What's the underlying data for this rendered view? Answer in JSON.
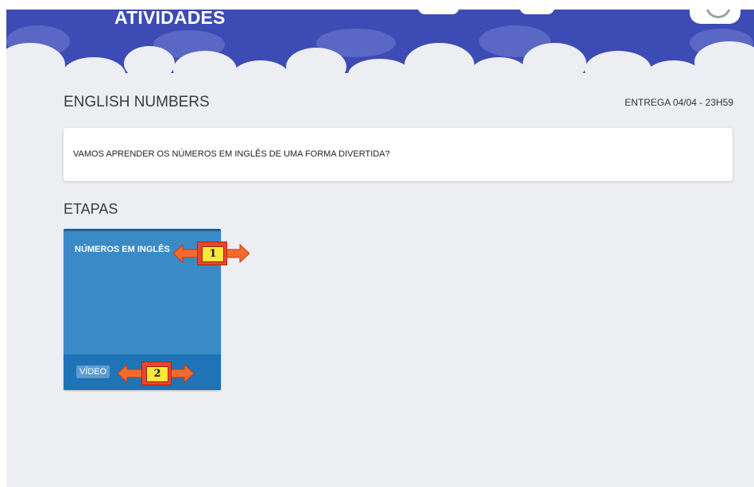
{
  "header": {
    "title": "ATIVIDADES",
    "background_color": "#3d4bb5",
    "profile_icon": "user-avatar-icon"
  },
  "activity": {
    "title": "ENGLISH NUMBERS",
    "deadline": "ENTREGA 04/04 - 23H59",
    "description": "VAMOS APRENDER OS NÚMEROS EM INGLÊS DE UMA FORMA DIVERTIDA?"
  },
  "steps": {
    "title": "ETAPAS",
    "items": [
      {
        "name": "NÚMEROS EM INGLÊS",
        "type": "VÍDEO",
        "card_color": "#3a8ac6",
        "footer_color": "#1f74b8"
      }
    ]
  },
  "annotations": [
    {
      "number": "1",
      "icon": "double-arrow-icon"
    },
    {
      "number": "2",
      "icon": "double-arrow-icon"
    }
  ]
}
